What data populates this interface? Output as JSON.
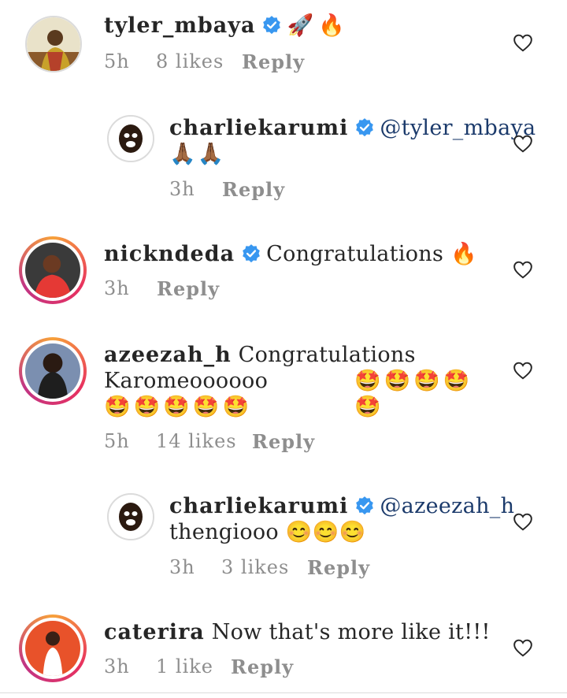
{
  "comments": [
    {
      "username": "tyler_mbaya",
      "text": "🚀🔥",
      "time": "5h",
      "likes": "8 likes",
      "reply": "Reply"
    },
    {
      "username": "charliekarumi",
      "mention": "@tyler_mbaya",
      "text": "🙏🏾🙏🏾",
      "time": "3h",
      "likes": "",
      "reply": "Reply"
    },
    {
      "username": "nickndeda",
      "text": "Congratulations 🔥",
      "time": "3h",
      "likes": "",
      "reply": "Reply"
    },
    {
      "username": "azeezah_h",
      "text": "Congratulations",
      "text2": "Karomeoooooo",
      "emoji_row1": "🤩🤩🤩🤩🤩",
      "emoji_row2": "🤩🤩🤩🤩🤩",
      "time": "5h",
      "likes": "14 likes",
      "reply": "Reply"
    },
    {
      "username": "charliekarumi",
      "mention": "@azeezah_h",
      "text": "thengiooo 😊😊😊",
      "time": "3h",
      "likes": "3 likes",
      "reply": "Reply"
    },
    {
      "username": "caterira",
      "text": "Now that's more like it!!!",
      "time": "3h",
      "likes": "1 like",
      "reply": "Reply"
    }
  ],
  "icons": {
    "verified": "verified-badge-icon",
    "like": "heart-outline-icon"
  },
  "colors": {
    "verified": "#3897f0",
    "mention": "#1b3a6b",
    "meta": "#8e8e8e",
    "ring_start": "#f7a13a",
    "ring_end": "#c13584"
  }
}
